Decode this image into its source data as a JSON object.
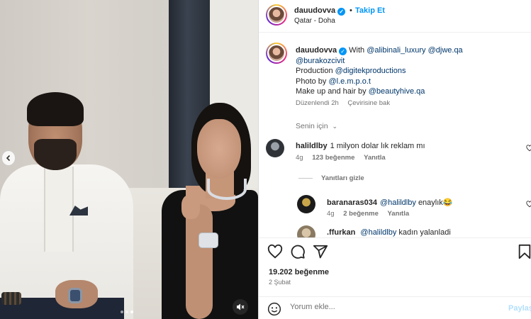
{
  "header": {
    "username": "dauudovva",
    "separator": "•",
    "follow_label": "Takip Et",
    "location": "Qatar - Doha"
  },
  "caption": {
    "username": "dauudovva",
    "with_label": "With",
    "mentions_line1": [
      "@alibinali_luxury",
      "@djwe.qa"
    ],
    "mention_line2": "@burakozcivit",
    "production_label": "Production",
    "production_mention": "@digitekproductions",
    "photo_label": "Photo by",
    "photo_mention": "@l.e.m.p.o.t",
    "makeup_label": "Make up and hair by",
    "makeup_mention": "@beautyhive.qa",
    "edited": "Düzenlendi",
    "time": "2h",
    "translate": "Çevirisine bak"
  },
  "for_you": "Senin için",
  "comments": [
    {
      "user": "halildlby",
      "text": "1 milyon dolar lık reklam mı",
      "time": "4g",
      "likes": "123 beğenme",
      "reply": "Yanıtla"
    },
    {
      "user": "baranaras034",
      "mention": "@halildlby",
      "text": "enaylık😂",
      "time": "4g",
      "likes": "2 beğenme",
      "reply": "Yanıtla"
    },
    {
      "user": ".ffurkan",
      "mention": "@halildlby",
      "text": "kadın yalanladi"
    }
  ],
  "hide_replies": "Yanıtları gizle",
  "likes": "19.202 beğenme",
  "date": "2 Şubat",
  "comment_input": {
    "placeholder": "Yorum ekle..."
  },
  "post_label": "Paylaş",
  "icons": [
    "heart-icon",
    "comment-icon",
    "share-icon",
    "bookmark-icon",
    "emoji-icon",
    "mute-icon",
    "chevron-left-icon"
  ],
  "colors": {
    "accent": "#0095f6",
    "mention": "#00376b",
    "muted": "#737373"
  }
}
